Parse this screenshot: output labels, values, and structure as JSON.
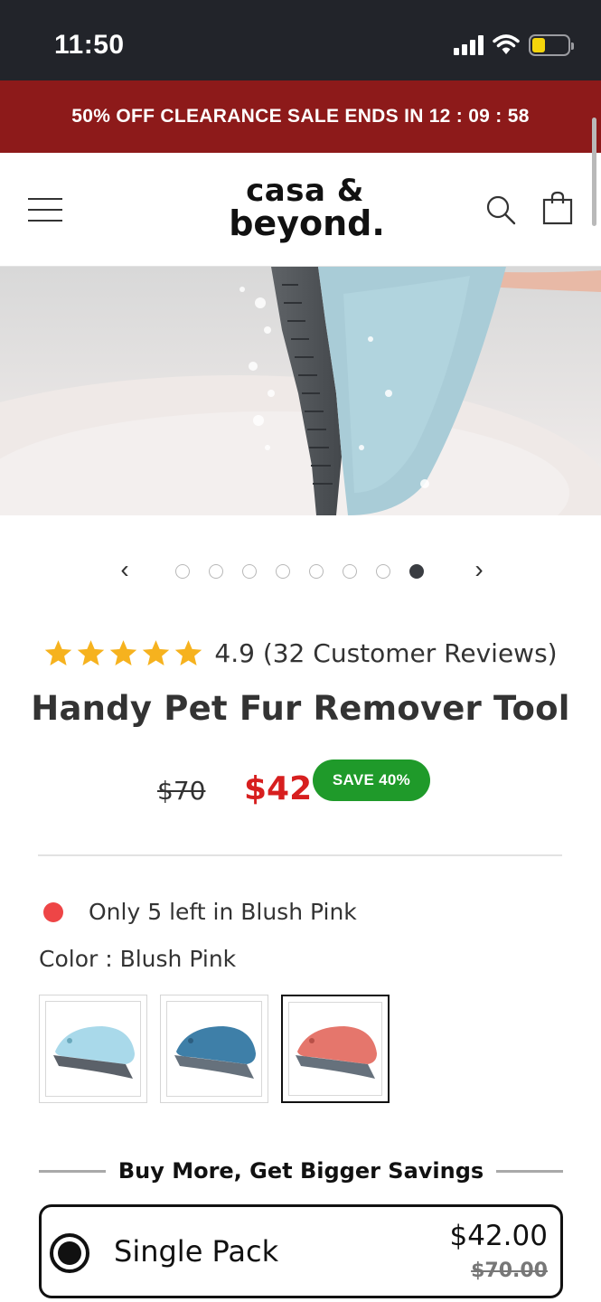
{
  "status_bar": {
    "time": "11:50"
  },
  "promo": {
    "text": "50% OFF CLEARANCE SALE ENDS IN",
    "countdown": "12 : 09 : 58"
  },
  "header": {
    "logo_line1": "casa &",
    "logo_line2": "beyond."
  },
  "carousel": {
    "total_slides": 8,
    "active_index": 7
  },
  "rating": {
    "stars": 5,
    "text": "4.9 (32 Customer Reviews)"
  },
  "product": {
    "title": "Handy Pet Fur Remover Tool",
    "old_price": "$70",
    "price": "$42",
    "save_badge": "SAVE 40%"
  },
  "stock": {
    "text": "Only 5 left in Blush Pink",
    "dot_color": "#ee4546"
  },
  "color_label": "Color : Blush Pink",
  "swatches": [
    {
      "color": "#a9d9ea",
      "selected": false
    },
    {
      "color": "#3e7fa8",
      "selected": false
    },
    {
      "color": "#e5766c",
      "selected": true
    }
  ],
  "bundle": {
    "heading": "Buy More, Get Bigger Savings",
    "options": [
      {
        "label": "Single Pack",
        "price": "$42.00",
        "old_price": "$70.00",
        "selected": true
      }
    ]
  },
  "colors": {
    "banner": "#8d1a1a",
    "price_red": "#d71f1f",
    "badge_green": "#1f9a2a",
    "star": "#f6b21e"
  }
}
